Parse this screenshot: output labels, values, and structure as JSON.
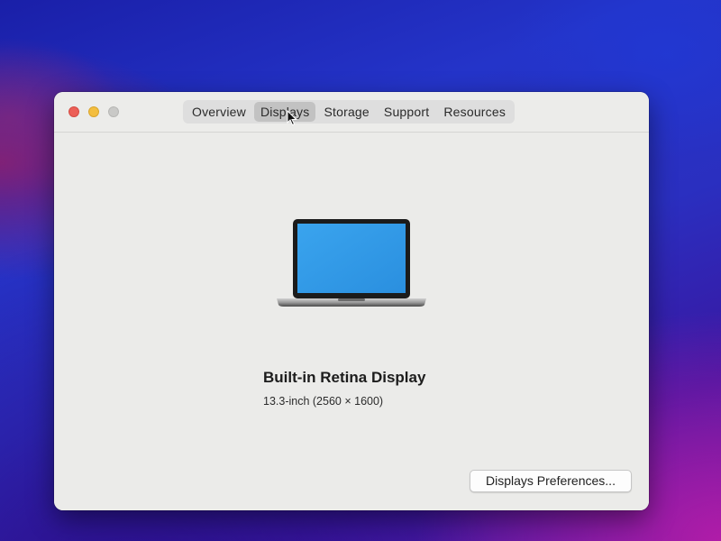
{
  "window": {
    "tabs": [
      {
        "label": "Overview",
        "active": false
      },
      {
        "label": "Displays",
        "active": true
      },
      {
        "label": "Storage",
        "active": false
      },
      {
        "label": "Support",
        "active": false
      },
      {
        "label": "Resources",
        "active": false
      }
    ]
  },
  "display": {
    "name": "Built-in Retina Display",
    "size": "13.3-inch (2560 × 1600)",
    "icon": "laptop-icon"
  },
  "buttons": {
    "preferences_label": "Displays Preferences..."
  },
  "colors": {
    "close": "#ec5f57",
    "minimize": "#f3be3f",
    "maximize": "#c9c9c7",
    "screen": "#2f9be8"
  }
}
